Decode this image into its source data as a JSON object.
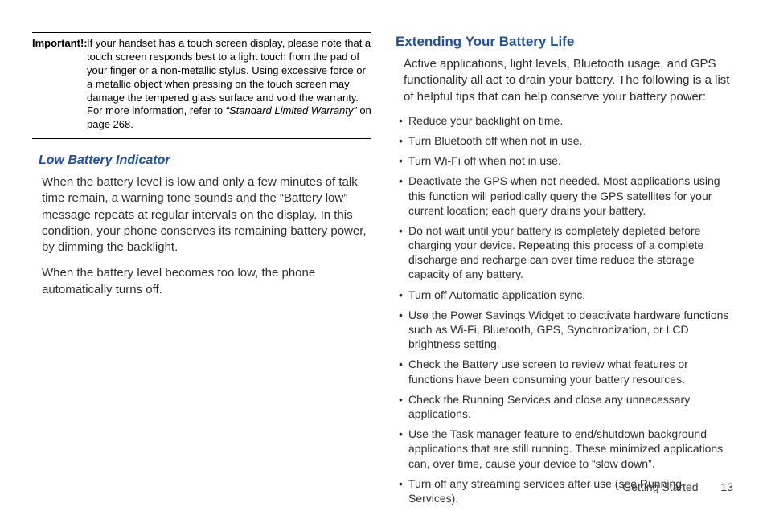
{
  "left": {
    "important_label": "Important!:",
    "important_text_1": "If your handset has a touch screen display, please note that a touch screen responds best to a light touch from the pad of your finger or a non-metallic stylus. Using excessive force or a metallic object when pressing on the touch screen may damage the tempered glass surface and void the warranty. For more information, refer to ",
    "important_text_italic": "“Standard Limited Warranty”",
    "important_text_2": "  on page 268.",
    "sub_heading": "Low Battery Indicator",
    "para1": "When the battery level is low and only a few minutes of talk time remain, a warning tone sounds and the “Battery low” message repeats at regular intervals on the display. In this condition, your phone conserves its remaining battery power, by dimming the backlight.",
    "para2": "When the battery level becomes too low, the phone automatically turns off."
  },
  "right": {
    "heading": "Extending Your Battery Life",
    "intro": "Active applications, light levels, Bluetooth usage, and GPS functionality all act to drain your battery. The following is a list of helpful tips that can help conserve your battery power:",
    "bullets": [
      "Reduce your backlight on time.",
      "Turn Bluetooth off when not in use.",
      "Turn Wi-Fi off when not in use.",
      "Deactivate the GPS when not needed. Most applications using this function will periodically query the GPS satellites for your current location; each query drains your battery.",
      "Do not wait until your battery is completely depleted before charging your device. Repeating this process of a complete discharge and recharge can over time reduce the storage capacity of any battery.",
      "Turn off Automatic application sync.",
      "Use the Power Savings Widget to deactivate hardware functions such as Wi-Fi, Bluetooth, GPS, Synchronization, or LCD brightness setting.",
      "Check the Battery use screen to review what features or functions have been consuming your battery resources.",
      "Check the Running Services and close any unnecessary applications.",
      "Use the Task manager feature to end/shutdown background applications that are still running. These minimized applications can, over time, cause your device to “slow down”.",
      "Turn off any streaming services after use (see Running Services)."
    ]
  },
  "footer": {
    "section": "Getting Started",
    "page": "13"
  }
}
